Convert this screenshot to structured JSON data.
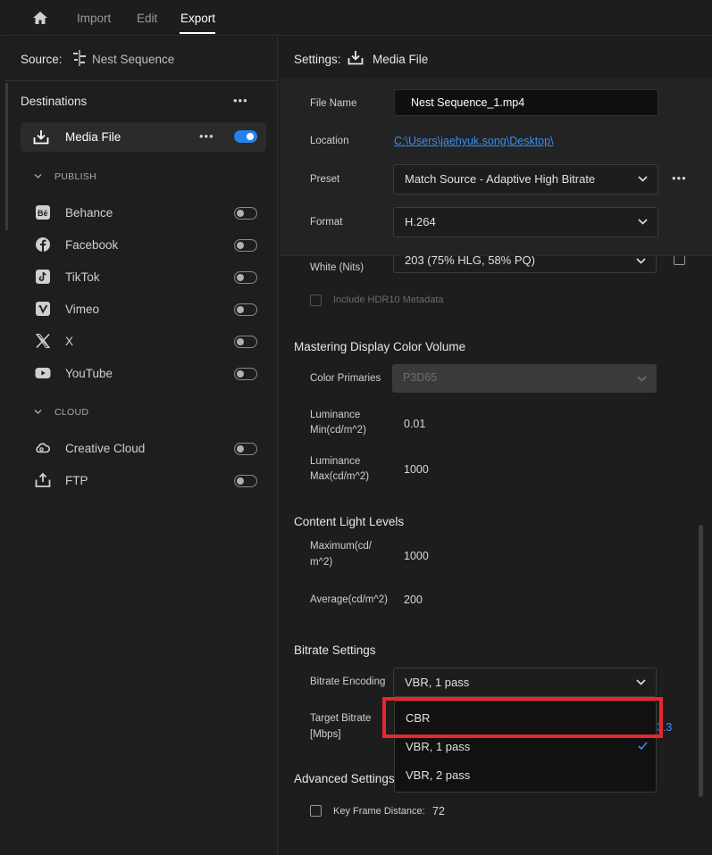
{
  "topbar": {
    "tabs": [
      "Import",
      "Edit",
      "Export"
    ],
    "active_tab": "Export"
  },
  "source": {
    "label": "Source:",
    "value": "Nest Sequence"
  },
  "destinations": {
    "title": "Destinations",
    "more": "•••",
    "media_file": {
      "label": "Media File",
      "more": "•••",
      "enabled": true
    },
    "publish_header": "PUBLISH",
    "publish": [
      {
        "label": "Behance",
        "icon": "behance-icon"
      },
      {
        "label": "Facebook",
        "icon": "facebook-icon"
      },
      {
        "label": "TikTok",
        "icon": "tiktok-icon"
      },
      {
        "label": "Vimeo",
        "icon": "vimeo-icon"
      },
      {
        "label": "X",
        "icon": "x-icon"
      },
      {
        "label": "YouTube",
        "icon": "youtube-icon"
      }
    ],
    "cloud_header": "CLOUD",
    "cloud": [
      {
        "label": "Creative Cloud",
        "icon": "creative-cloud-icon"
      },
      {
        "label": "FTP",
        "icon": "ftp-upload-icon"
      }
    ]
  },
  "settings": {
    "label": "Settings:",
    "value": "Media File",
    "file_name_label": "File Name",
    "file_name": "Nest Sequence_1.mp4",
    "location_label": "Location",
    "location": "C:\\Users\\jaehyuk.song\\Desktop\\",
    "preset_label": "Preset",
    "preset": "Match Source - Adaptive High Bitrate",
    "preset_more": "•••",
    "format_label": "Format",
    "format": "H.264"
  },
  "hdr": {
    "white_label": "White (Nits)",
    "white_value": "203 (75% HLG, 58% PQ)",
    "include_metadata": "Include HDR10 Metadata"
  },
  "mastering": {
    "title": "Mastering Display Color Volume",
    "primaries_label": "Color Primaries",
    "primaries_value": "P3D65",
    "lum_min_label_1": "Luminance",
    "lum_min_label_2": "Min(cd/m^2)",
    "lum_min": "0.01",
    "lum_max_label_1": "Luminance",
    "lum_max_label_2": "Max(cd/m^2)",
    "lum_max": "1000"
  },
  "light_levels": {
    "title": "Content Light Levels",
    "max_label_1": "Maximum(cd/",
    "max_label_2": "m^2)",
    "max_value": "1000",
    "avg_label": "Average(cd/m^2)",
    "avg_value": "200"
  },
  "bitrate": {
    "title": "Bitrate Settings",
    "encoding_label": "Bitrate Encoding",
    "encoding_value": "VBR, 1 pass",
    "target_label_1": "Target Bitrate",
    "target_label_2": "[Mbps]",
    "target_value_partial": "3.3",
    "options": [
      "CBR",
      "VBR, 1 pass",
      "VBR, 2 pass"
    ],
    "selected_option": "VBR, 1 pass"
  },
  "advanced": {
    "title": "Advanced Settings",
    "keyframe_label": "Key Frame Distance:",
    "keyframe_value": "72"
  },
  "colors": {
    "accent": "#2680eb",
    "highlight": "#e8262d",
    "link": "#3a8ef0"
  }
}
